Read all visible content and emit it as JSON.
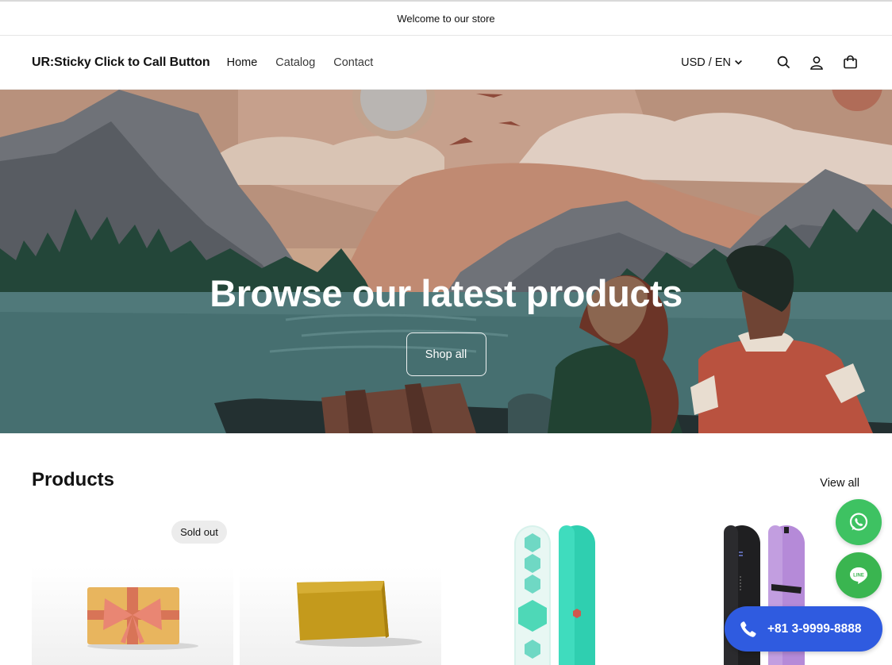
{
  "announcement": {
    "text": "Welcome to our store"
  },
  "header": {
    "brand": "UR:Sticky Click to Call Button",
    "nav": [
      {
        "label": "Home"
      },
      {
        "label": "Catalog"
      },
      {
        "label": "Contact"
      }
    ],
    "locale": "USD / EN",
    "icons": [
      "search-icon",
      "account-icon",
      "cart-icon"
    ]
  },
  "hero": {
    "title": "Browse our latest products",
    "button": "Shop all"
  },
  "products": {
    "title": "Products",
    "view_all": "View all",
    "items": [
      {
        "badge": "Sold out",
        "image": "gift-card"
      },
      {
        "badge": "",
        "image": "wax-bar"
      },
      {
        "badge": "",
        "image": "snowboard-teal"
      },
      {
        "badge": "",
        "image": "snowboard-black-purple"
      }
    ]
  },
  "floating": {
    "whatsapp_icon": "whatsapp-icon",
    "line_icon": "line-icon",
    "line_text": "LINE",
    "call_number": "+81 3-9999-8888"
  },
  "colors": {
    "call_button": "#2f5be0",
    "whatsapp": "#3ec262",
    "line": "#3ab550"
  }
}
